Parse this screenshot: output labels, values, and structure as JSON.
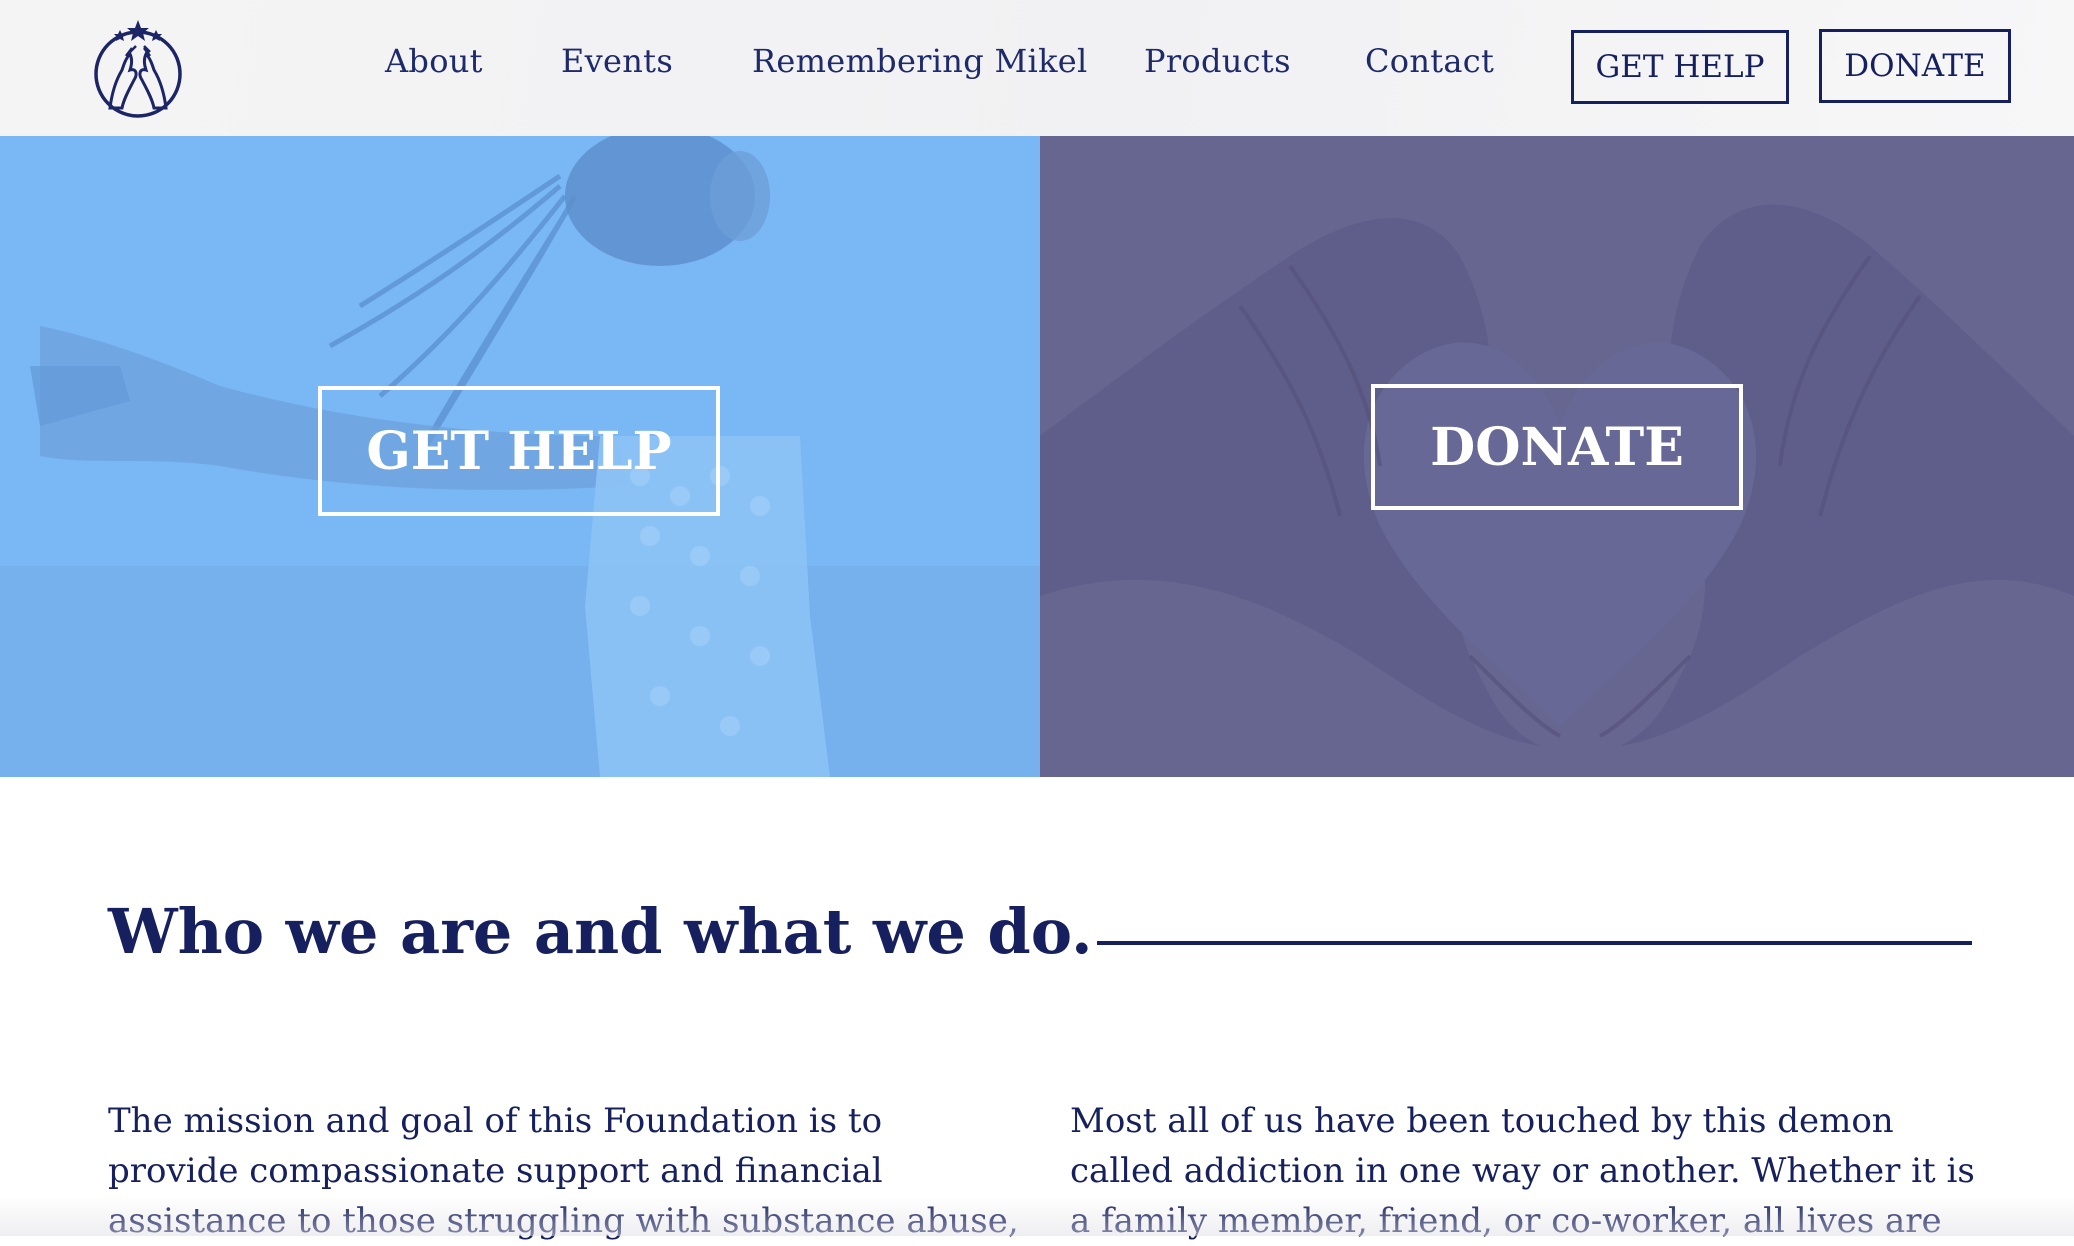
{
  "header": {
    "logo_icon": "foundation-hands-stars-logo",
    "nav": [
      "About",
      "Events",
      "Remembering Mikel",
      "Products",
      "Contact"
    ],
    "get_help_label": "GET HELP",
    "donate_label": "DONATE"
  },
  "hero": {
    "left": {
      "label": "GET HELP",
      "overlay_color": "#7ab7f5",
      "image": "woman-arms-outstretched-photo"
    },
    "right": {
      "label": "DONATE",
      "overlay_color": "#666690",
      "image": "hands-heart-shape-photo"
    }
  },
  "about": {
    "title": "Who we are and what we do.",
    "left_paragraph": [
      "The mission and goal of this Foundation is to",
      "provide compassionate support and financial",
      "assistance to those struggling with substance abuse,"
    ],
    "right_paragraph": [
      "Most all of us have been touched by this demon",
      "called addiction in one way or another.  Whether it is",
      "a family member, friend, or co-worker, all lives are"
    ]
  },
  "colors": {
    "navy": "#17205e",
    "nav_text": "#1f2a6b",
    "header_bg": "#f3f3f4"
  }
}
